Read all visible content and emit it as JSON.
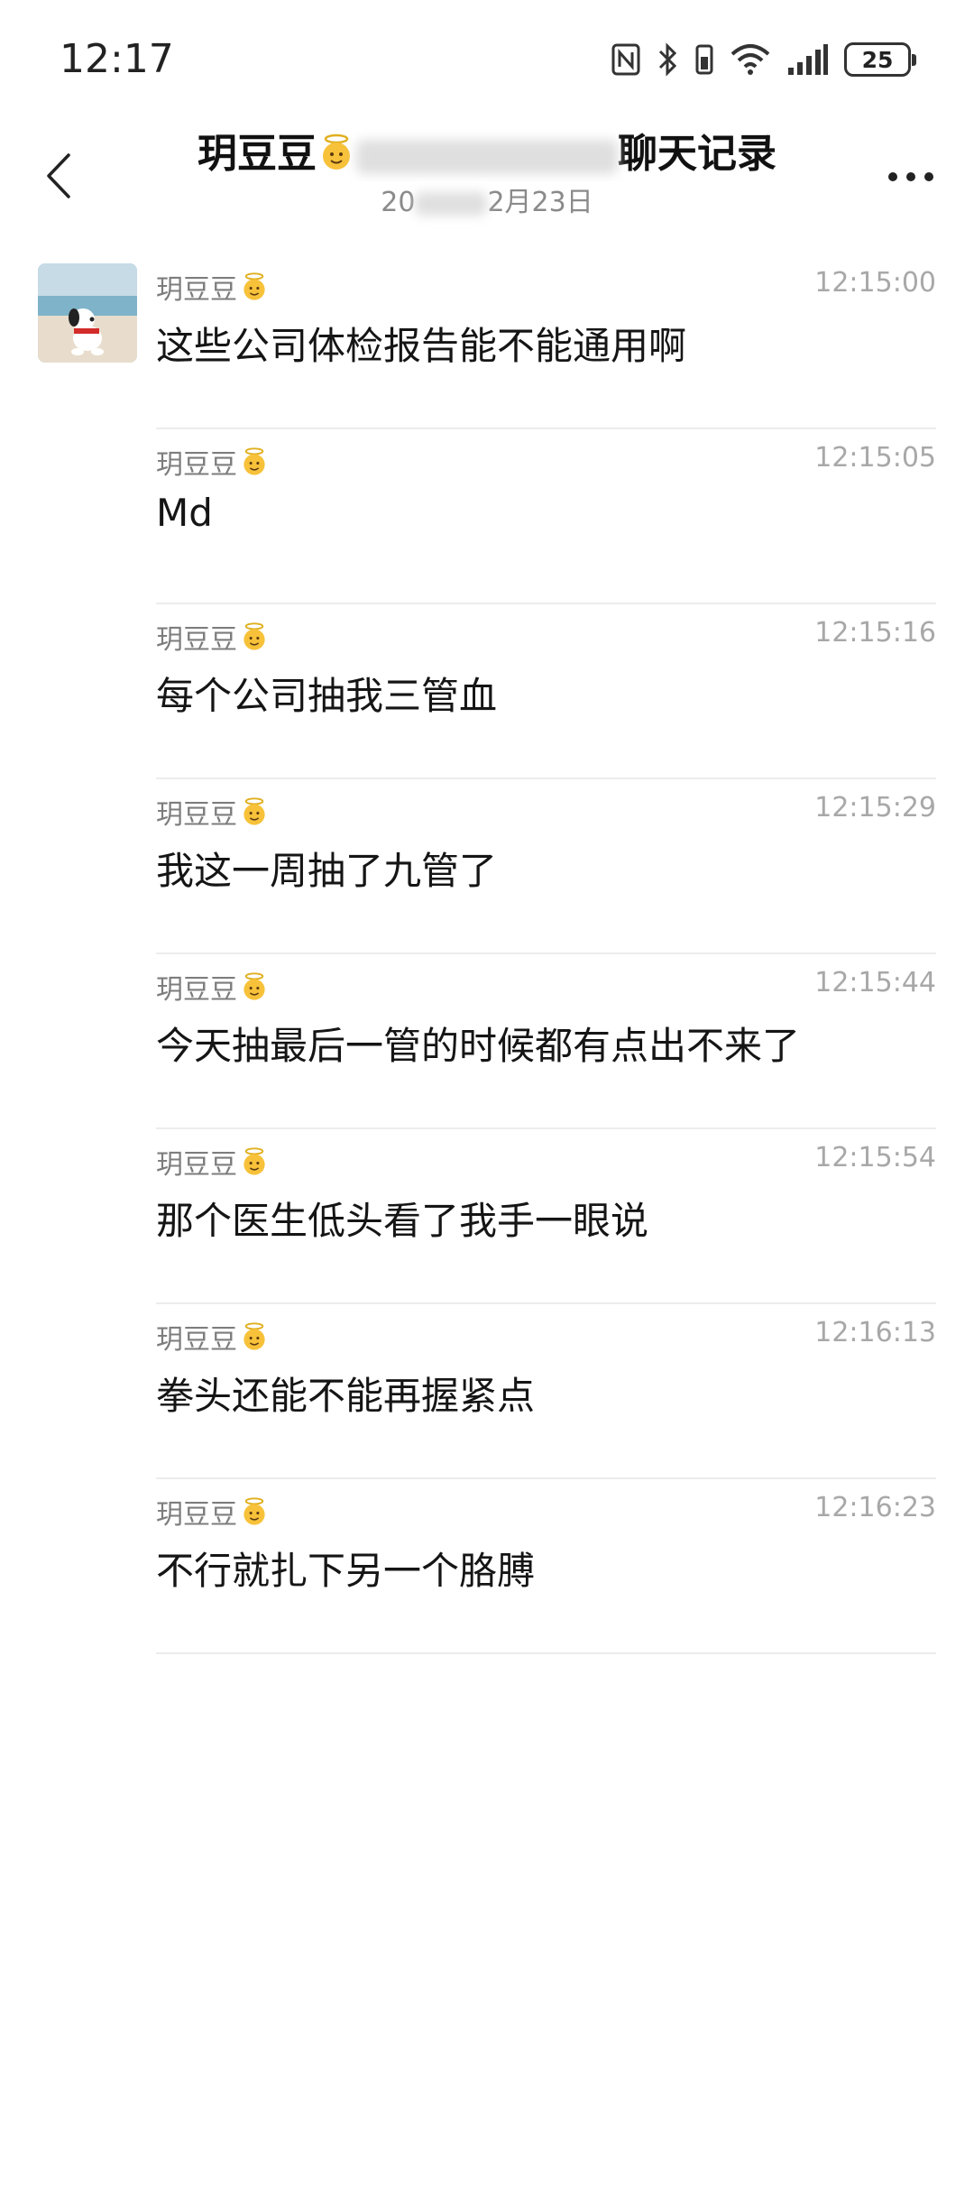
{
  "status_bar": {
    "time": "12:17",
    "battery": "25",
    "icons": [
      "nfc-icon",
      "bluetooth-icon",
      "vibrate-icon",
      "wifi-icon",
      "signal-icon",
      "battery-icon"
    ]
  },
  "header": {
    "title_left": "玥豆豆",
    "title_right": "聊天记录",
    "subtitle_left": "20",
    "subtitle_right": "2月23日",
    "back_icon": "chevron-left-icon",
    "more_icon": "more-dots-icon"
  },
  "sender_name": "玥豆豆",
  "messages": [
    {
      "sender": "玥豆豆",
      "time": "12:15:00",
      "text": "这些公司体检报告能不能通用啊"
    },
    {
      "sender": "玥豆豆",
      "time": "12:15:05",
      "text": "Md"
    },
    {
      "sender": "玥豆豆",
      "time": "12:15:16",
      "text": "每个公司抽我三管血"
    },
    {
      "sender": "玥豆豆",
      "time": "12:15:29",
      "text": "我这一周抽了九管了"
    },
    {
      "sender": "玥豆豆",
      "time": "12:15:44",
      "text": "今天抽最后一管的时候都有点出不来了"
    },
    {
      "sender": "玥豆豆",
      "time": "12:15:54",
      "text": "那个医生低头看了我手一眼说"
    },
    {
      "sender": "玥豆豆",
      "time": "12:16:13",
      "text": "拳头还能不能再握紧点"
    },
    {
      "sender": "玥豆豆",
      "time": "12:16:23",
      "text": "不行就扎下另一个胳膊"
    }
  ]
}
